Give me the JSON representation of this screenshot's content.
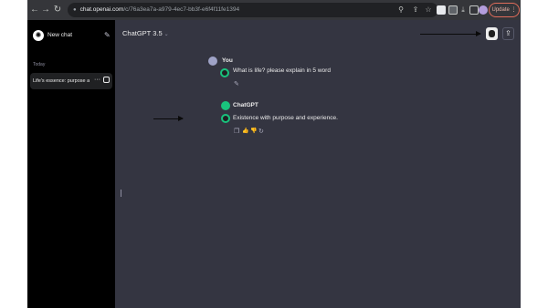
{
  "browser": {
    "url_host": "chat.openai.com",
    "url_path": "/c/76a3ea7a-a979-4ec7-bb3f-e6f4f11fe1394",
    "update_label": "Update"
  },
  "sidebar": {
    "new_chat_label": "New chat",
    "section_today": "Today",
    "chat_title": "Life's essence: purpose and experience",
    "more_label": "···"
  },
  "main": {
    "model_name": "ChatGPT 3.5",
    "model_chevron": "⌄"
  },
  "conversation": {
    "user_name": "You",
    "user_message": "What is life? please explain in 5 word",
    "assistant_name": "ChatGPT",
    "assistant_message": "Existence with purpose and experience."
  },
  "icons": {
    "back": "←",
    "forward": "→",
    "reload": "↻",
    "edit": "✎",
    "copy": "❐",
    "thumbs_up": "👍",
    "thumbs_down": "👎",
    "regenerate": "↻",
    "share": "⇪",
    "menu": "⋮",
    "search": "⚲",
    "star": "☆",
    "download": "⤓"
  },
  "colors": {
    "sidebar_bg": "#000000",
    "main_bg": "#343541",
    "accent_green": "#19c37d",
    "update_border": "#e06c5a"
  }
}
